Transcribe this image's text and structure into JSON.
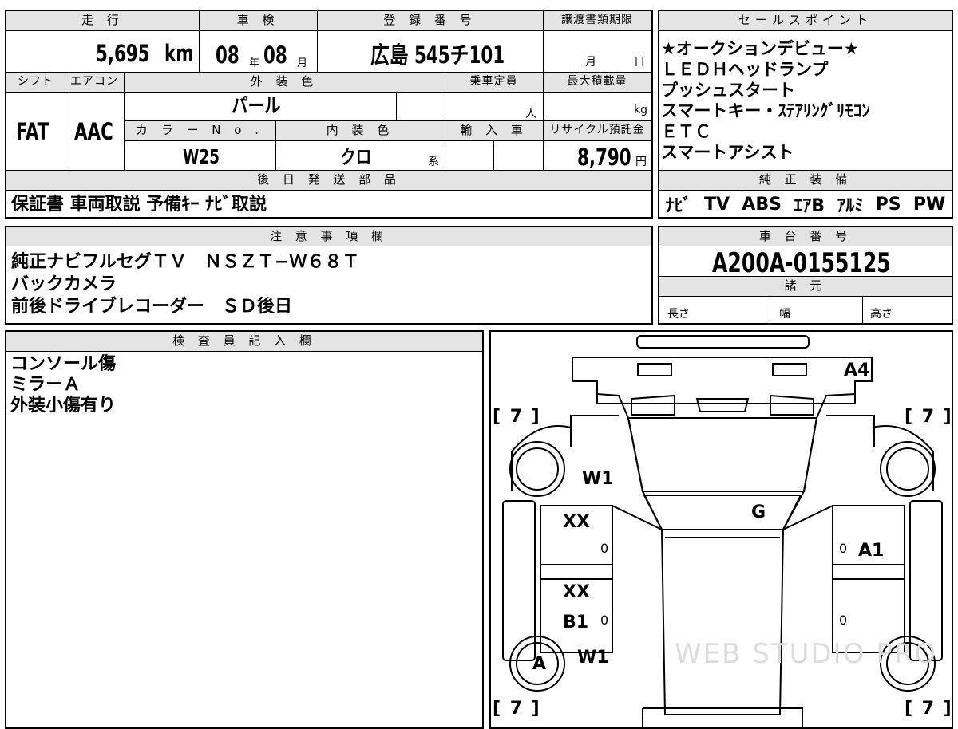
{
  "top_fields": {
    "headers": {
      "mileage": "走 行",
      "inspection": "車 検",
      "registration": "登 録 番 号",
      "transfer_deadline": "譲渡書類期限",
      "shift": "シフト",
      "aircon": "エアコン",
      "exterior_color": "外 装 色",
      "capacity": "乗車定員",
      "max_load": "最大積載量",
      "color_no": "カ ラ ー N o .",
      "interior_color": "内 装 色",
      "import": "輸 入 車",
      "recycle": "リサイクル預託金",
      "later_parts": "後 日 発 送 部 品"
    },
    "mileage_value": "5,695",
    "mileage_unit": "km",
    "inspection_year": "08",
    "year_unit": "年",
    "inspection_month": "08",
    "month_unit": "月",
    "registration_value": "広島 545チ101",
    "deadline_month_unit": "月",
    "deadline_day_unit": "日",
    "shift_value": "FAT",
    "aircon_value": "AAC",
    "exterior_color_value": "パール",
    "capacity_unit": "人",
    "load_unit": "kg",
    "color_no_value": "W25",
    "interior_color_value": "クロ",
    "interior_suffix": "系",
    "recycle_value": "8,790",
    "recycle_unit": "円",
    "later_parts_value": "保証書 車両取説 予備ｷｰ ﾅﾋﾞ取説"
  },
  "sales_points": {
    "header": "セールスポイント",
    "lines": "★オークションデビュー★\nＬＥＤＨヘッドランプ\nプッシュスタート\nスマートキー・ｽﾃｱﾘﾝｸﾞﾘﾓｺﾝ\nＥＴＣ\nスマートアシスト"
  },
  "equipment": {
    "header": "純 正 装 備",
    "items": [
      "ﾅﾋﾞ",
      "TV",
      "ABS",
      "ｴｱB",
      "ｱﾙﾐ",
      "PS",
      "PW"
    ]
  },
  "notes": {
    "header": "注 意 事 項 欄",
    "lines": "純正ナビフルセグＴＶ　ＮＳＺＴ−Ｗ６８Ｔ\nバックカメラ\n前後ドライブレコーダー　ＳＤ後日"
  },
  "chassis": {
    "header": "車 台 番 号",
    "value": "A200A-0155125",
    "specs_header": "諸 元",
    "length_label": "長さ",
    "width_label": "幅",
    "height_label": "高さ"
  },
  "inspector": {
    "header": "検 査 員 記 入 欄",
    "lines": "コンソール傷\nミラーＡ\n外装小傷有り"
  },
  "diagram": {
    "marks": {
      "a4": "A4",
      "w1_front": "W1",
      "g": "G",
      "xx_front": "XX",
      "a1": "A1",
      "xx_rear": "XX",
      "b1": "B1",
      "w1_rear": "W1",
      "wheel_a": "A"
    },
    "tread": "[ 7 ]",
    "zero": "0",
    "watermark": "WEB STUDIO PRO"
  }
}
